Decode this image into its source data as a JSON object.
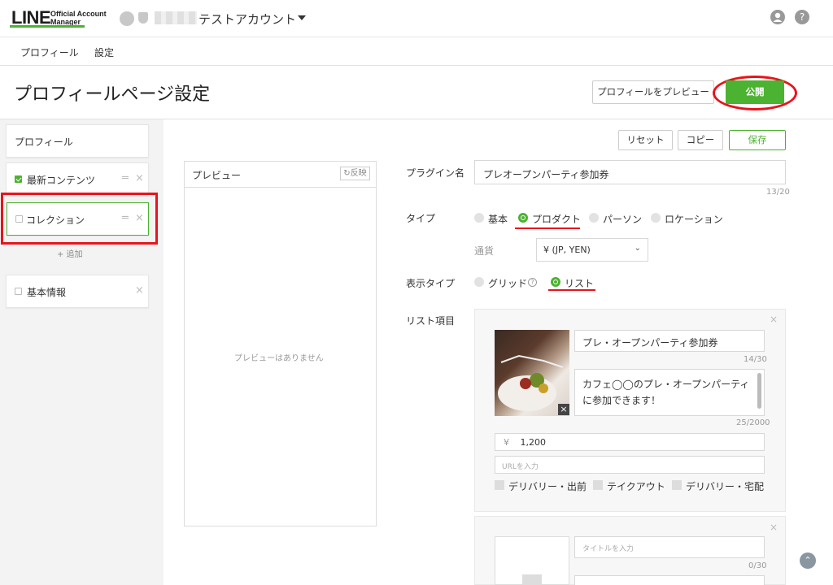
{
  "header": {
    "logo": "LINE",
    "logo_sub1": "Official Account",
    "logo_sub2": "Manager",
    "account_name": "テストアカウント",
    "user_icon": "user-icon",
    "help_icon": "help-icon",
    "help_glyph": "?"
  },
  "tabs": [
    {
      "label": "プロフィール",
      "active": true
    },
    {
      "label": "設定",
      "active": false
    }
  ],
  "page": {
    "title": "プロフィールページ設定",
    "preview_button": "プロフィールをプレビュー",
    "publish_button": "公開"
  },
  "sidebar": {
    "profile_label": "プロフィール",
    "items": [
      {
        "label": "最新コンテンツ",
        "checked": true
      },
      {
        "label": "コレクション",
        "checked": false
      }
    ],
    "add_label": "+ 追加",
    "basic_label": "基本情報"
  },
  "toolbar": {
    "reset": "リセット",
    "copy": "コピー",
    "save": "保存"
  },
  "preview": {
    "title": "プレビュー",
    "flip": "反映",
    "empty": "プレビューはありません"
  },
  "form": {
    "plugin_label": "プラグイン名",
    "plugin_value": "プレオープンパーティ参加券",
    "plugin_count": "13/20",
    "type_label": "タイプ",
    "type_options": [
      "基本",
      "プロダクト",
      "パーソン",
      "ロケーション"
    ],
    "type_selected": "プロダクト",
    "currency_label": "通貨",
    "currency_value": "¥ (JP, YEN)",
    "display_label": "表示タイプ",
    "display_options": [
      "グリッド",
      "リスト"
    ],
    "display_selected": "リスト",
    "list_label": "リスト項目",
    "item1": {
      "title": "プレ・オープンパーティ参加券",
      "title_count": "14/30",
      "desc_line1": "カフェ◯◯のプレ・オープンパーティ",
      "desc_line2": "に参加できます！",
      "desc_count": "25/2000",
      "price_symbol": "¥",
      "price": "1,200",
      "url_placeholder": "URLを入力",
      "options": [
        "デリバリー・出前",
        "テイクアウト",
        "デリバリー・宅配"
      ]
    },
    "item2": {
      "title_placeholder": "タイトルを入力",
      "title_count": "0/30"
    }
  },
  "colors": {
    "accent": "#4cb231",
    "highlight": "#e8141c"
  }
}
